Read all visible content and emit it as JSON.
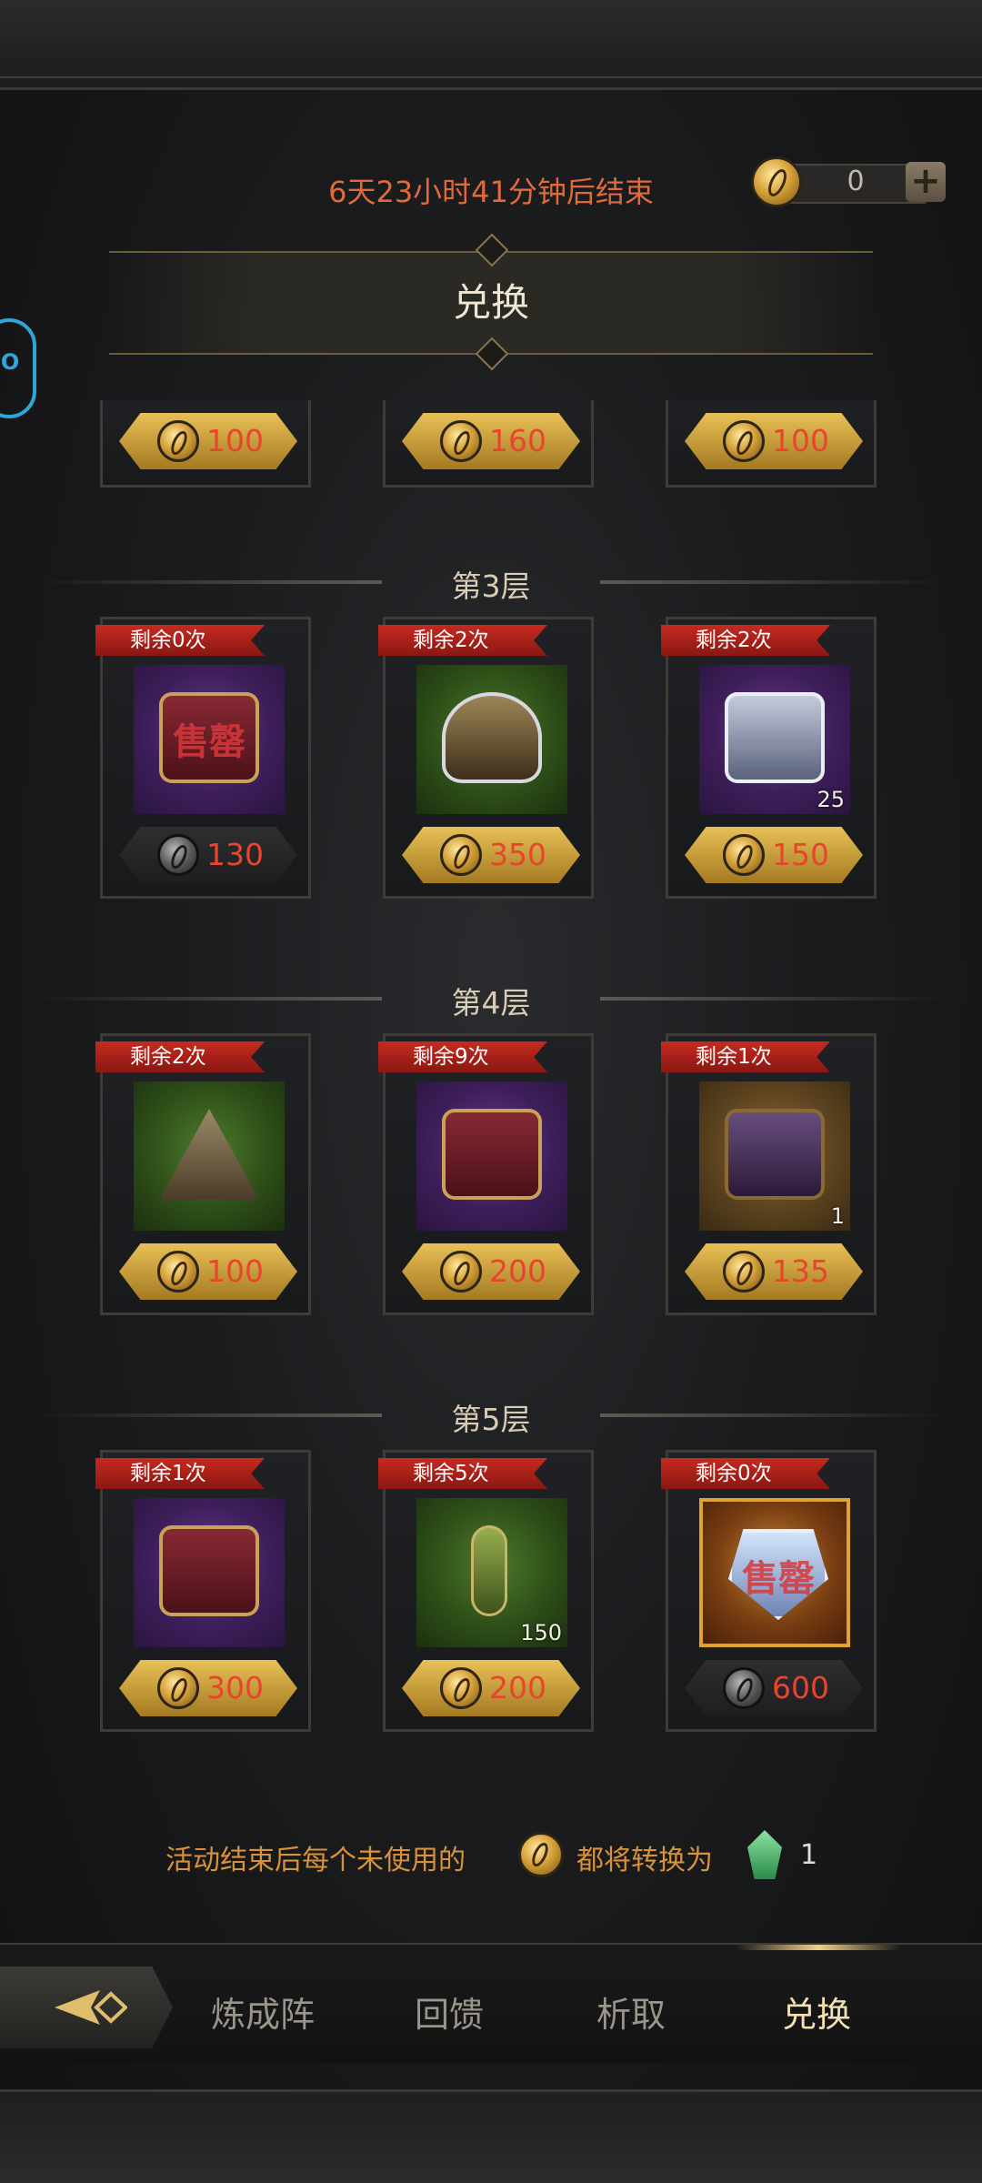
{
  "header": {
    "timer": "6天23小时41分钟后结束",
    "title": "兑换",
    "currency_value": "0",
    "plus_label": "+"
  },
  "top_row_prices": [
    "100",
    "160",
    "100"
  ],
  "layers": [
    {
      "label": "第3层",
      "items": [
        {
          "ribbon": "剩余0次",
          "price": "130",
          "coin": "dark",
          "bg": "purple",
          "obj": "red",
          "sold_out": "售罄",
          "qty": ""
        },
        {
          "ribbon": "剩余2次",
          "price": "350",
          "coin": "gold",
          "bg": "green",
          "obj": "spike",
          "sold_out": "",
          "qty": ""
        },
        {
          "ribbon": "剩余2次",
          "price": "150",
          "coin": "gold",
          "bg": "purple",
          "obj": "silver",
          "sold_out": "",
          "qty": "25"
        }
      ]
    },
    {
      "label": "第4层",
      "items": [
        {
          "ribbon": "剩余2次",
          "price": "100",
          "coin": "gold",
          "bg": "green",
          "obj": "pyr",
          "sold_out": "",
          "qty": ""
        },
        {
          "ribbon": "剩余9次",
          "price": "200",
          "coin": "gold",
          "bg": "purple",
          "obj": "red",
          "sold_out": "",
          "qty": ""
        },
        {
          "ribbon": "剩余1次",
          "price": "135",
          "coin": "gold",
          "bg": "gold",
          "obj": "dark",
          "sold_out": "",
          "qty": "1"
        }
      ]
    },
    {
      "label": "第5层",
      "items": [
        {
          "ribbon": "剩余1次",
          "price": "300",
          "coin": "gold",
          "bg": "purple",
          "obj": "red",
          "sold_out": "",
          "qty": ""
        },
        {
          "ribbon": "剩余5次",
          "price": "200",
          "coin": "gold",
          "bg": "green",
          "obj": "staff",
          "sold_out": "",
          "qty": "150"
        },
        {
          "ribbon": "剩余0次",
          "price": "600",
          "coin": "dark",
          "bg": "orange",
          "obj": "crystal",
          "sold_out": "售罄",
          "qty": ""
        }
      ]
    }
  ],
  "notice": {
    "text_before": "活动结束后每个未使用的",
    "text_after": "都将转换为",
    "gem_count": "1"
  },
  "nav": {
    "tabs": [
      "炼成阵",
      "回馈",
      "析取",
      "兑换"
    ],
    "active_index": 3
  },
  "colors": {
    "price_red": "#e8452e",
    "timer_orange": "#e06a3c",
    "ribbon_red": "#c62a20",
    "gold": "#e8c056"
  }
}
